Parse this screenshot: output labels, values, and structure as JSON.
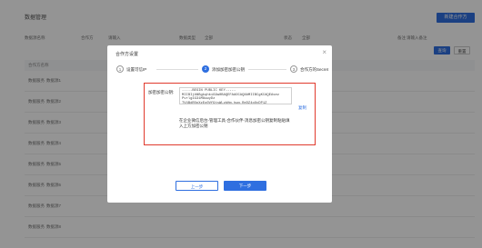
{
  "background": {
    "title": "数据管理",
    "primary_button": "新建合作方",
    "filters": [
      "数据源名称",
      "合作方",
      "请输入",
      "数据类型",
      "全部",
      "状态",
      "全部",
      "备注",
      "请输入备注"
    ],
    "query_button": "查询",
    "reset_button": "重置",
    "columns": [
      "合作方名称",
      "数据源",
      "创建人",
      "创建时间",
      "状态",
      "备注",
      "操作"
    ],
    "rows": [
      [
        "数据服务",
        "数据源1",
        "",
        "",
        "",
        "",
        ""
      ],
      [
        "数据服务",
        "数据源2",
        "",
        "",
        "",
        "",
        ""
      ],
      [
        "数据服务",
        "数据源3",
        "",
        "",
        "",
        "",
        ""
      ],
      [
        "数据服务",
        "数据源4",
        "",
        "",
        "",
        "",
        ""
      ],
      [
        "数据服务",
        "数据源5",
        "",
        "",
        "",
        "",
        ""
      ],
      [
        "数据服务",
        "数据源6",
        "",
        "",
        "",
        "",
        ""
      ],
      [
        "数据服务",
        "数据源7",
        "",
        "",
        "",
        "",
        ""
      ],
      [
        "数据服务",
        "数据源8",
        "",
        "",
        "",
        "",
        ""
      ]
    ]
  },
  "modal": {
    "title": "合作方设置",
    "close_icon": "×",
    "steps": [
      {
        "num": "1",
        "label": "设置可信IP",
        "state": "inactive"
      },
      {
        "num": "2",
        "label": "添加加密加密公钥",
        "state": "active"
      },
      {
        "num": "3",
        "label": "合作方的Secret",
        "state": "inactive"
      }
    ],
    "field_label": "加密加密公钥:",
    "public_key": "-----BEGIN PUBLIC KEY-----\nMIIBIjANBgkqhkiG9w0BAQEFAAOCAQ8AMIIBCgKCAQEAsez\nPvrlg1G31M8uwyDz\nTV4BdRQpXzEo0Vf9tsWLzbHm.hwg.ReDZ4oOcDP1Z\nmlHgqfkTDS",
    "copy_label": "复制",
    "hint": "在企业微信后台-管理工具-合作伙伴-消息加密公钥复制粘贴填入上方加密公钥",
    "prev_button": "上一步",
    "next_button": "下一步",
    "accent_color": "#2f6fe0",
    "highlight_color": "#e03a2d"
  }
}
